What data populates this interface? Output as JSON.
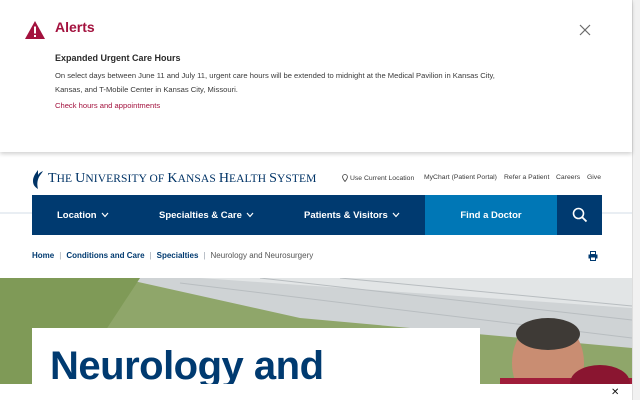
{
  "alert": {
    "title": "Alerts",
    "heading": "Expanded Urgent Care Hours",
    "body": "On select days between June 11 and July 11, urgent care hours will be extended to midnight at the Medical Pavilion in Kansas City, Kansas, and T-Mobile Center in Kansas City, Missouri.",
    "link": "Check hours and appointments",
    "icon": "warning-triangle-icon",
    "close_icon": "close-icon"
  },
  "header": {
    "logo_text": "The University of Kansas Health System",
    "utility_links": [
      "Use Current Location",
      "MyChart (Patient Portal)",
      "Refer a Patient",
      "Careers",
      "Give"
    ]
  },
  "nav": {
    "items": [
      "Location",
      "Specialties & Care",
      "Patients & Visitors"
    ],
    "find_doctor": "Find a Doctor",
    "search_icon": "search-icon"
  },
  "breadcrumb": {
    "items": [
      "Home",
      "Conditions and Care",
      "Specialties"
    ],
    "current": "Neurology and Neurosurgery"
  },
  "hero": {
    "title": "Neurology and"
  },
  "colors": {
    "brand_navy": "#003a70",
    "accent_blue": "#0077b6",
    "alert_red": "#a3123e"
  }
}
